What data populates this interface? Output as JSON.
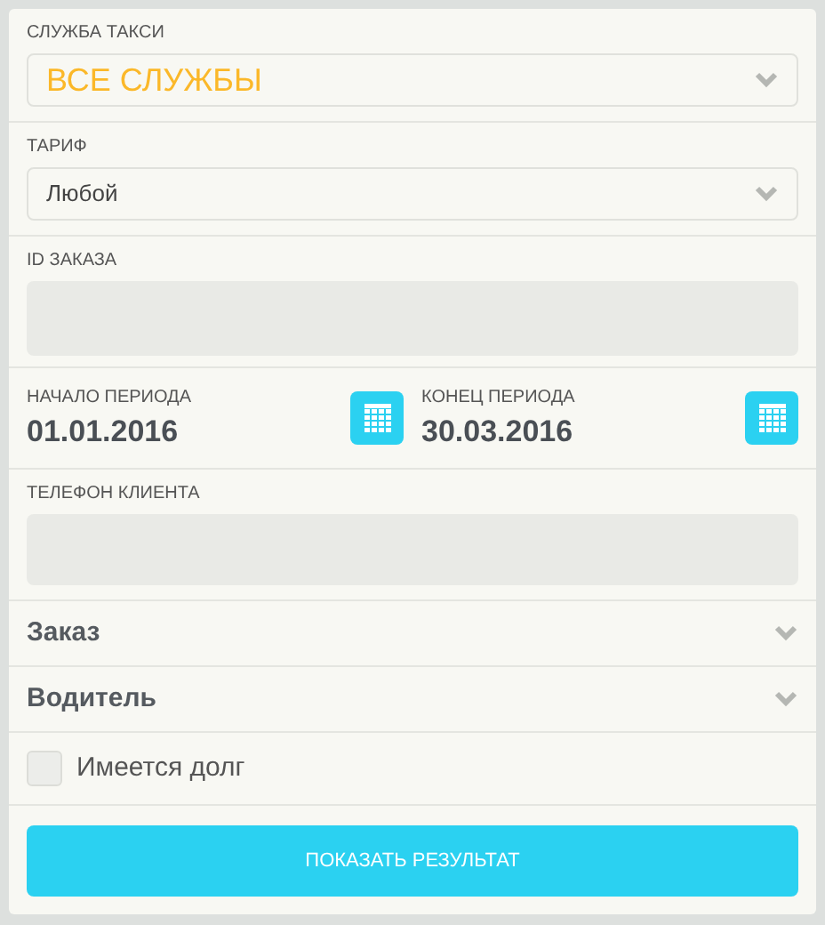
{
  "taxi_service": {
    "label": "СЛУЖБА ТАКСИ",
    "value": "ВСЕ СЛУЖБЫ"
  },
  "tariff": {
    "label": "ТАРИФ",
    "value": "Любой"
  },
  "order_id": {
    "label": "ID ЗАКАЗА"
  },
  "period": [
    {
      "label": "НАЧАЛО ПЕРИОДА",
      "value": "01.01.2016"
    },
    {
      "label": "КОНЕЦ ПЕРИОДА",
      "value": "30.03.2016"
    }
  ],
  "client_phone": {
    "label": "ТЕЛЕФОН КЛИЕНТА"
  },
  "sections": [
    {
      "title": "Заказ",
      "expanded": false
    },
    {
      "title": "Водитель",
      "expanded": false
    }
  ],
  "debt": {
    "label": "Имеется долг",
    "checked": false
  },
  "submit_button": "ПОКАЗАТЬ РЕЗУЛЬТАТ"
}
